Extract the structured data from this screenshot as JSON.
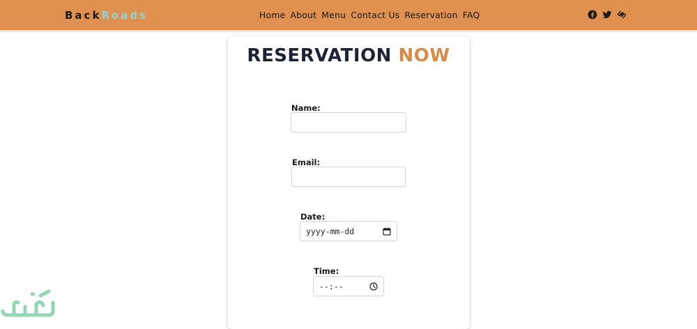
{
  "brand": {
    "part1": "Back",
    "part2": "Roads"
  },
  "nav": [
    "Home",
    "About",
    "Menu",
    "Contact Us",
    "Reservation",
    "FAQ"
  ],
  "social": [
    "facebook-icon",
    "twitter-icon",
    "squarespace-icon"
  ],
  "title": {
    "main": "RESERVATION",
    "accent": "NOW"
  },
  "form": {
    "name_label": "Name:",
    "name_value": "",
    "email_label": "Email:",
    "email_value": "",
    "date_label": "Date:",
    "date_placeholder": "yyyy-mm-dd",
    "time_label": "Time:",
    "time_placeholder": "--:--"
  },
  "colors": {
    "navbar": "#e0914f",
    "brand_accent": "#8fd3d5",
    "title": "#1a2338",
    "title_accent": "#d98a45"
  }
}
